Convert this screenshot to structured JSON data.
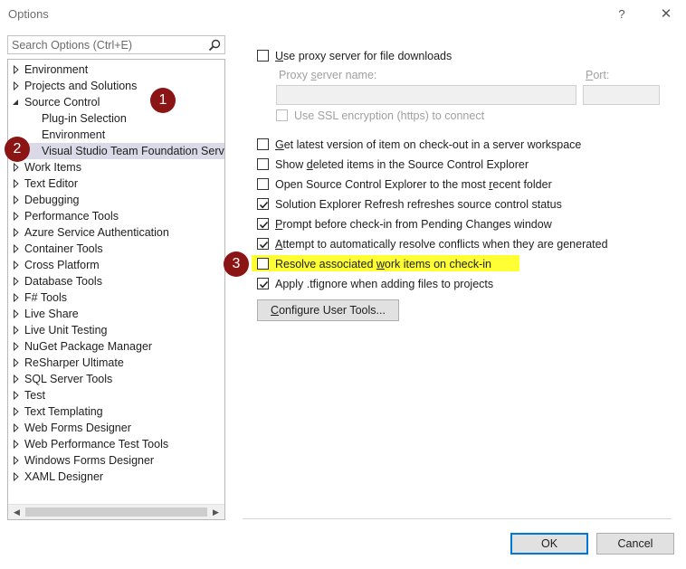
{
  "window": {
    "title": "Options",
    "help": "?",
    "close": "✕"
  },
  "search": {
    "placeholder": "Search Options (Ctrl+E)"
  },
  "tree": {
    "items": [
      {
        "label": "Environment",
        "state": "collapsed",
        "level": 0
      },
      {
        "label": "Projects and Solutions",
        "state": "collapsed",
        "level": 0
      },
      {
        "label": "Source Control",
        "state": "expanded",
        "level": 0
      },
      {
        "label": "Plug-in Selection",
        "state": "leaf",
        "level": 1
      },
      {
        "label": "Environment",
        "state": "leaf",
        "level": 1
      },
      {
        "label": "Visual Studio Team Foundation Server",
        "state": "leaf",
        "level": 1,
        "selected": true
      },
      {
        "label": "Work Items",
        "state": "collapsed",
        "level": 0
      },
      {
        "label": "Text Editor",
        "state": "collapsed",
        "level": 0
      },
      {
        "label": "Debugging",
        "state": "collapsed",
        "level": 0
      },
      {
        "label": "Performance Tools",
        "state": "collapsed",
        "level": 0
      },
      {
        "label": "Azure Service Authentication",
        "state": "collapsed",
        "level": 0
      },
      {
        "label": "Container Tools",
        "state": "collapsed",
        "level": 0
      },
      {
        "label": "Cross Platform",
        "state": "collapsed",
        "level": 0
      },
      {
        "label": "Database Tools",
        "state": "collapsed",
        "level": 0
      },
      {
        "label": "F# Tools",
        "state": "collapsed",
        "level": 0
      },
      {
        "label": "Live Share",
        "state": "collapsed",
        "level": 0
      },
      {
        "label": "Live Unit Testing",
        "state": "collapsed",
        "level": 0
      },
      {
        "label": "NuGet Package Manager",
        "state": "collapsed",
        "level": 0
      },
      {
        "label": "ReSharper Ultimate",
        "state": "collapsed",
        "level": 0
      },
      {
        "label": "SQL Server Tools",
        "state": "collapsed",
        "level": 0
      },
      {
        "label": "Test",
        "state": "collapsed",
        "level": 0
      },
      {
        "label": "Text Templating",
        "state": "collapsed",
        "level": 0
      },
      {
        "label": "Web Forms Designer",
        "state": "collapsed",
        "level": 0
      },
      {
        "label": "Web Performance Test Tools",
        "state": "collapsed",
        "level": 0
      },
      {
        "label": "Windows Forms Designer",
        "state": "collapsed",
        "level": 0
      },
      {
        "label": "XAML Designer",
        "state": "collapsed",
        "level": 0
      }
    ],
    "scroll_left": "◀",
    "scroll_right": "▶"
  },
  "proxy": {
    "use_proxy": {
      "pre": "",
      "accel": "U",
      "post": "se proxy server for file downloads",
      "checked": false
    },
    "server_label": {
      "pre": "Proxy ",
      "accel": "s",
      "post": "erver name:"
    },
    "port_label": {
      "pre": "",
      "accel": "P",
      "post": "ort:"
    },
    "server_value": "",
    "port_value": "",
    "ssl": {
      "pre": "Use SSL encryption (https) to connect",
      "checked": false,
      "disabled": true
    }
  },
  "options": [
    {
      "pre": "",
      "accel": "G",
      "post": "et latest version of item on check-out in a server workspace",
      "checked": false
    },
    {
      "pre": "Show ",
      "accel": "d",
      "post": "eleted items in the Source Control Explorer",
      "checked": false
    },
    {
      "pre": "Open Source Control Explorer to the most ",
      "accel": "r",
      "post": "ecent folder",
      "checked": false
    },
    {
      "pre": "Solution Explorer Refresh refreshes source control status",
      "accel": "",
      "post": "",
      "checked": true
    },
    {
      "pre": "",
      "accel": "P",
      "post": "rompt before check-in from Pending Changes window",
      "checked": true
    },
    {
      "pre": "",
      "accel": "A",
      "post": "ttempt to automatically resolve conflicts when they are generated",
      "checked": true
    },
    {
      "pre": "Resolve associated ",
      "accel": "w",
      "post": "ork items on check-in",
      "checked": false
    },
    {
      "pre": "Apply .tfignore when adding files to projects",
      "accel": "",
      "post": "",
      "checked": true
    }
  ],
  "configure_button": {
    "pre": "",
    "accel": "C",
    "post": "onfigure User Tools..."
  },
  "footer": {
    "ok": "OK",
    "cancel": "Cancel"
  },
  "annotations": [
    "1",
    "2",
    "3"
  ],
  "colors": {
    "badge": "#8b1414",
    "highlight": "#ffff33",
    "selection": "#d9d9e8",
    "accent": "#0078d7"
  }
}
